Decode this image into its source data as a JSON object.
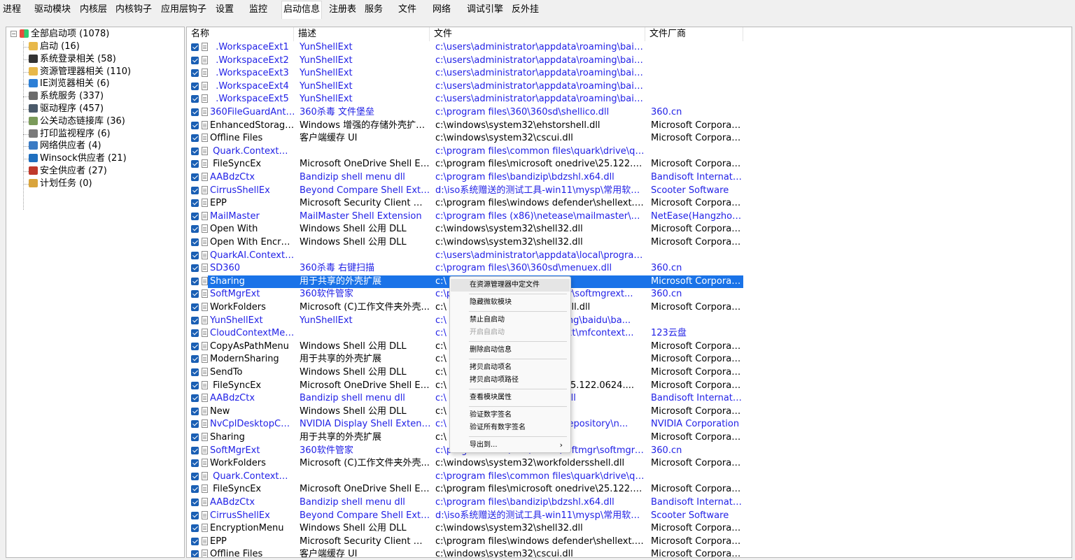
{
  "tabs": [
    "进程",
    "驱动模块",
    "内核层",
    "内核钩子",
    "应用层钩子",
    "设置",
    "监控",
    "启动信息",
    "注册表",
    "服务",
    "文件",
    "网络",
    "调试引擎",
    "反外挂"
  ],
  "active_tab": "启动信息",
  "tree": {
    "root": {
      "label": "全部启动项 (1078)",
      "icon": "windows-flag-icon",
      "expander": "−"
    },
    "items": [
      {
        "label": "启动 (16)",
        "icon": "folder-icon",
        "color": "#e8b84a"
      },
      {
        "label": "系统登录相关 (58)",
        "icon": "user-icon",
        "color": "#333333"
      },
      {
        "label": "资源管理器相关 (110)",
        "icon": "folder-open-icon",
        "color": "#e8b84a"
      },
      {
        "label": "IE浏览器相关 (6)",
        "icon": "ie-icon",
        "color": "#2d7fd6"
      },
      {
        "label": "系统服务 (337)",
        "icon": "gears-icon",
        "color": "#6b6b6b"
      },
      {
        "label": "驱动程序 (457)",
        "icon": "computer-icon",
        "color": "#4a5a6a"
      },
      {
        "label": "公关动态链接库 (36)",
        "icon": "dll-icon",
        "color": "#7a9a5a"
      },
      {
        "label": "打印监视程序 (6)",
        "icon": "printer-icon",
        "color": "#7a7a7a"
      },
      {
        "label": "网络供应者 (4)",
        "icon": "network-icon",
        "color": "#3b7bc4"
      },
      {
        "label": "Winsock供应者 (21)",
        "icon": "globe-icon",
        "color": "#1f6fbf"
      },
      {
        "label": "安全供应者 (27)",
        "icon": "shield-icon",
        "color": "#c0392b"
      },
      {
        "label": "计划任务 (0)",
        "icon": "scheduled-task-icon",
        "color": "#d9a43c"
      }
    ]
  },
  "columns": [
    "名称",
    "描述",
    "文件",
    "文件厂商"
  ],
  "rows": [
    {
      "name": "  .WorkspaceExt1",
      "desc": "YunShellExt",
      "file": "c:\\users\\administrator\\appdata\\roaming\\baidu\\ba...",
      "vendor": "",
      "blue": true
    },
    {
      "name": "  .WorkspaceExt2",
      "desc": "YunShellExt",
      "file": "c:\\users\\administrator\\appdata\\roaming\\baidu\\ba...",
      "vendor": "",
      "blue": true
    },
    {
      "name": "  .WorkspaceExt3",
      "desc": "YunShellExt",
      "file": "c:\\users\\administrator\\appdata\\roaming\\baidu\\ba...",
      "vendor": "",
      "blue": true
    },
    {
      "name": "  .WorkspaceExt4",
      "desc": "YunShellExt",
      "file": "c:\\users\\administrator\\appdata\\roaming\\baidu\\ba...",
      "vendor": "",
      "blue": true
    },
    {
      "name": "  .WorkspaceExt5",
      "desc": "YunShellExt",
      "file": "c:\\users\\administrator\\appdata\\roaming\\baidu\\ba...",
      "vendor": "",
      "blue": true
    },
    {
      "name": "360FileGuardAntiDel",
      "desc": "360杀毒 文件堡垒",
      "file": "c:\\program files\\360\\360sd\\shellico.dll",
      "vendor": "360.cn",
      "blue": true
    },
    {
      "name": "EnhancedStorageS...",
      "desc": "Windows 增强的存储外壳扩展...",
      "file": "c:\\windows\\system32\\ehstorshell.dll",
      "vendor": "Microsoft Corporation",
      "blue": false
    },
    {
      "name": "Offline Files",
      "desc": "客户端缓存 UI",
      "file": "c:\\windows\\system32\\cscui.dll",
      "vendor": "Microsoft Corporation",
      "blue": false
    },
    {
      "name": " Quark.ContextMe...",
      "desc": "",
      "file": "c:\\program files\\common files\\quark\\drive\\quark...",
      "vendor": "",
      "blue": true
    },
    {
      "name": " FileSyncEx",
      "desc": "Microsoft OneDrive Shell Exte...",
      "file": "c:\\program files\\microsoft onedrive\\25.122.0624....",
      "vendor": "Microsoft Corporation",
      "blue": false
    },
    {
      "name": "AABdzCtx",
      "desc": "Bandizip shell menu dll",
      "file": "c:\\program files\\bandizip\\bdzshl.x64.dll",
      "vendor": "Bandisoft Internatio...",
      "blue": true
    },
    {
      "name": "CirrusShellEx",
      "desc": "Beyond Compare Shell Extens...",
      "file": "d:\\iso系统赠送的测试工具-win11\\mysp\\常用软件...",
      "vendor": "Scooter Software",
      "blue": true
    },
    {
      "name": "EPP",
      "desc": "Microsoft Security Client 外壳...",
      "file": "c:\\program files\\windows defender\\shellext.dll",
      "vendor": "Microsoft Corporation",
      "blue": false
    },
    {
      "name": "MailMaster",
      "desc": "MailMaster Shell Extension",
      "file": "c:\\program files (x86)\\netease\\mailmaster\\applic...",
      "vendor": "NetEase(Hangzhou)...",
      "blue": true
    },
    {
      "name": "Open With",
      "desc": "Windows Shell 公用 DLL",
      "file": "c:\\windows\\system32\\shell32.dll",
      "vendor": "Microsoft Corporation",
      "blue": false
    },
    {
      "name": "Open With Encrypt...",
      "desc": "Windows Shell 公用 DLL",
      "file": "c:\\windows\\system32\\shell32.dll",
      "vendor": "Microsoft Corporation",
      "blue": false
    },
    {
      "name": "QuarkAI.ContextM...",
      "desc": "",
      "file": "c:\\users\\administrator\\appdata\\local\\programs\\co...",
      "vendor": "",
      "blue": true
    },
    {
      "name": "SD360",
      "desc": "360杀毒 右键扫描",
      "file": "c:\\program files\\360\\360sd\\menuex.dll",
      "vendor": "360.cn",
      "blue": true
    },
    {
      "name": "Sharing",
      "desc": "用于共享的外壳扩展",
      "file": "c:\\",
      "vendor": "Microsoft Corporation",
      "blue": false,
      "selected": true
    },
    {
      "name": "SoftMgrExt",
      "desc": "360软件管家",
      "file": "c:\\p                                   mgr\\softmgrext...",
      "vendor": "360.cn",
      "blue": true
    },
    {
      "name": "WorkFolders",
      "desc": "Microsoft (C)工作文件夹外壳...",
      "file": "c:\\                                    sshell.dll",
      "vendor": "Microsoft Corporation",
      "blue": false
    },
    {
      "name": "YunShellExt",
      "desc": "YunShellExt",
      "file": "c:\\                                    aming\\baidu\\ba...",
      "vendor": "",
      "blue": true
    },
    {
      "name": "CloudContextMenu...",
      "desc": "",
      "file": "c:\\                                    ellext\\mfcontext...",
      "vendor": "123云盘",
      "blue": true
    },
    {
      "name": "CopyAsPathMenu",
      "desc": "Windows Shell 公用 DLL",
      "file": "c:\\",
      "vendor": "Microsoft Corporation",
      "blue": false
    },
    {
      "name": "ModernSharing",
      "desc": "用于共享的外壳扩展",
      "file": "c:\\",
      "vendor": "Microsoft Corporation",
      "blue": false
    },
    {
      "name": "SendTo",
      "desc": "Windows Shell 公用 DLL",
      "file": "c:\\",
      "vendor": "Microsoft Corporation",
      "blue": false
    },
    {
      "name": " FileSyncEx",
      "desc": "Microsoft OneDrive Shell Exte...",
      "file": "c:\\                                    ve\\25.122.0624....",
      "vendor": "Microsoft Corporation",
      "blue": false
    },
    {
      "name": "AABdzCtx",
      "desc": "Bandizip shell menu dll",
      "file": "c:\\                                    64.dll",
      "vendor": "Bandisoft Internatio...",
      "blue": true
    },
    {
      "name": "New",
      "desc": "Windows Shell 公用 DLL",
      "file": "c:\\",
      "vendor": "Microsoft Corporation",
      "blue": false
    },
    {
      "name": "NvCplDesktopCont...",
      "desc": "NVIDIA Display Shell Extension",
      "file": "c:\\                                    filerepository\\n...",
      "vendor": "NVIDIA Corporation",
      "blue": true
    },
    {
      "name": "Sharing",
      "desc": "用于共享的外壳扩展",
      "file": "c:\\",
      "vendor": "Microsoft Corporation",
      "blue": false
    },
    {
      "name": "SoftMgrExt",
      "desc": "360软件管家",
      "file": "c:\\program files\\360\\360sd\\softmgr\\softmgrext...",
      "vendor": "360.cn",
      "blue": true
    },
    {
      "name": "WorkFolders",
      "desc": "Microsoft (C)工作文件夹外壳...",
      "file": "c:\\windows\\system32\\workfoldersshell.dll",
      "vendor": "Microsoft Corporation",
      "blue": false
    },
    {
      "name": " Quark.ContextMe...",
      "desc": "",
      "file": "c:\\program files\\common files\\quark\\drive\\quark...",
      "vendor": "",
      "blue": true
    },
    {
      "name": " FileSyncEx",
      "desc": "Microsoft OneDrive Shell Exte...",
      "file": "c:\\program files\\microsoft onedrive\\25.122.0624....",
      "vendor": "Microsoft Corporation",
      "blue": false
    },
    {
      "name": "AABdzCtx",
      "desc": "Bandizip shell menu dll",
      "file": "c:\\program files\\bandizip\\bdzshl.x64.dll",
      "vendor": "Bandisoft Internatio...",
      "blue": true
    },
    {
      "name": "CirrusShellEx",
      "desc": "Beyond Compare Shell Extens...",
      "file": "d:\\iso系统赠送的测试工具-win11\\mysp\\常用软件...",
      "vendor": "Scooter Software",
      "blue": true
    },
    {
      "name": "EncryptionMenu",
      "desc": "Windows Shell 公用 DLL",
      "file": "c:\\windows\\system32\\shell32.dll",
      "vendor": "Microsoft Corporation",
      "blue": false
    },
    {
      "name": "EPP",
      "desc": "Microsoft Security Client 外壳...",
      "file": "c:\\program files\\windows defender\\shellext.dll",
      "vendor": "Microsoft Corporation",
      "blue": false
    },
    {
      "name": "Offline Files",
      "desc": "客户端缓存 UI",
      "file": "c:\\windows\\system32\\cscui.dll",
      "vendor": "Microsoft Corporation",
      "blue": false
    }
  ],
  "context_menu": {
    "items": [
      {
        "label": "在资源管理器中定文件",
        "name": "menu-locate-in-explorer",
        "highlight": true
      },
      {
        "sep": true
      },
      {
        "label": "隐藏微软模块",
        "name": "menu-hide-microsoft-modules"
      },
      {
        "sep": true
      },
      {
        "label": "禁止自启动",
        "name": "menu-disable-autostart"
      },
      {
        "label": "开启自启动",
        "name": "menu-enable-autostart",
        "disabled": true
      },
      {
        "sep": true
      },
      {
        "label": "删除启动信息",
        "name": "menu-delete-startup-info"
      },
      {
        "sep": true
      },
      {
        "label": "拷贝启动项名",
        "name": "menu-copy-item-name"
      },
      {
        "label": "拷贝启动项路径",
        "name": "menu-copy-item-path"
      },
      {
        "sep": true
      },
      {
        "label": "查看模块属性",
        "name": "menu-view-module-properties"
      },
      {
        "sep": true
      },
      {
        "label": "验证数字签名",
        "name": "menu-verify-signature"
      },
      {
        "label": "验证所有数字签名",
        "name": "menu-verify-all-signatures"
      },
      {
        "sep": true
      },
      {
        "label": "导出到...",
        "name": "menu-export-to",
        "submenu": true,
        "arrow": "›"
      }
    ]
  }
}
